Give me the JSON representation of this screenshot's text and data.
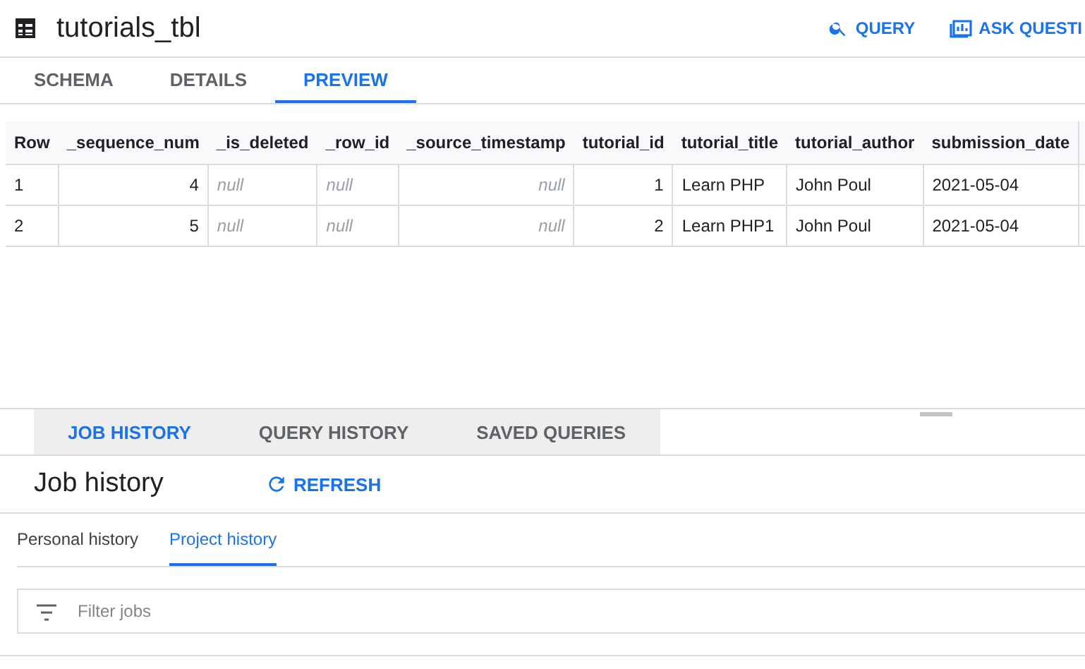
{
  "header": {
    "title": "tutorials_tbl",
    "actions": [
      {
        "label": "QUERY",
        "kind": "search"
      },
      {
        "label": "ASK QUESTI",
        "kind": "chart"
      }
    ]
  },
  "tabs": [
    {
      "label": "SCHEMA",
      "selected": false
    },
    {
      "label": "DETAILS",
      "selected": false
    },
    {
      "label": "PREVIEW",
      "selected": true
    }
  ],
  "table": {
    "columns": [
      {
        "label": "Row",
        "kind": "text"
      },
      {
        "label": "_sequence_num",
        "kind": "number"
      },
      {
        "label": "_is_deleted",
        "kind": "text"
      },
      {
        "label": "_row_id",
        "kind": "text"
      },
      {
        "label": "_source_timestamp",
        "kind": "number"
      },
      {
        "label": "tutorial_id",
        "kind": "number"
      },
      {
        "label": "tutorial_title",
        "kind": "text"
      },
      {
        "label": "tutorial_author",
        "kind": "text"
      },
      {
        "label": "submission_date",
        "kind": "text"
      }
    ],
    "rows": [
      [
        {
          "text": "1",
          "kind": "value"
        },
        {
          "text": "4",
          "kind": "value"
        },
        {
          "text": "null",
          "kind": "null"
        },
        {
          "text": "null",
          "kind": "null"
        },
        {
          "text": "null",
          "kind": "null"
        },
        {
          "text": "1",
          "kind": "value"
        },
        {
          "text": "Learn PHP",
          "kind": "value"
        },
        {
          "text": "John Poul",
          "kind": "value"
        },
        {
          "text": "2021-05-04",
          "kind": "value"
        }
      ],
      [
        {
          "text": "2",
          "kind": "value"
        },
        {
          "text": "5",
          "kind": "value"
        },
        {
          "text": "null",
          "kind": "null"
        },
        {
          "text": "null",
          "kind": "null"
        },
        {
          "text": "null",
          "kind": "null"
        },
        {
          "text": "2",
          "kind": "value"
        },
        {
          "text": "Learn PHP1",
          "kind": "value"
        },
        {
          "text": "John Poul",
          "kind": "value"
        },
        {
          "text": "2021-05-04",
          "kind": "value"
        }
      ]
    ]
  },
  "history_tabs": [
    {
      "label": "JOB HISTORY",
      "selected": true
    },
    {
      "label": "QUERY HISTORY",
      "selected": false
    },
    {
      "label": "SAVED QUERIES",
      "selected": false
    }
  ],
  "job_history": {
    "title": "Job history",
    "refresh": "REFRESH",
    "subtabs": [
      {
        "label": "Personal history",
        "selected": false
      },
      {
        "label": "Project history",
        "selected": true
      }
    ],
    "filter": {
      "placeholder": "Filter jobs"
    }
  }
}
